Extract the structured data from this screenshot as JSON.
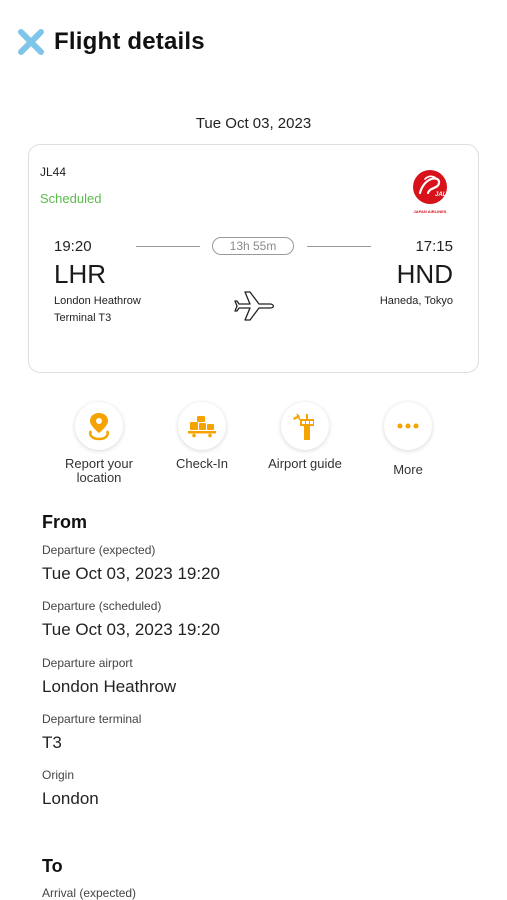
{
  "header": {
    "title": "Flight details"
  },
  "flight": {
    "date": "Tue Oct 03, 2023",
    "number": "JL44",
    "status": "Scheduled",
    "airline_logo_text": "JAPAN AIRLINES",
    "airline_logo_mark": "JAL",
    "departure": {
      "time": "19:20",
      "code": "LHR",
      "airport": "London Heathrow",
      "terminal": "Terminal T3"
    },
    "arrival": {
      "time": "17:15",
      "code": "HND",
      "airport": "Haneda, Tokyo"
    },
    "duration": "13h 55m"
  },
  "actions": [
    {
      "label": "Report your location",
      "icon": "location-pin-icon"
    },
    {
      "label": "Check-In",
      "icon": "luggage-cart-icon"
    },
    {
      "label": "Airport guide",
      "icon": "control-tower-icon"
    },
    {
      "label": "More",
      "icon": "more-dots-icon"
    }
  ],
  "from": {
    "title": "From",
    "fields": [
      {
        "label": "Departure (expected)",
        "value": "Tue Oct 03, 2023 19:20"
      },
      {
        "label": "Departure (scheduled)",
        "value": "Tue Oct 03, 2023 19:20"
      },
      {
        "label": "Departure airport",
        "value": "London Heathrow"
      },
      {
        "label": "Departure terminal",
        "value": "T3"
      },
      {
        "label": "Origin",
        "value": "London"
      }
    ]
  },
  "to": {
    "title": "To",
    "fields": [
      {
        "label": "Arrival (expected)"
      }
    ]
  },
  "colors": {
    "accent": "#f5a300",
    "close_icon": "#7fc4e9",
    "status_green": "#5dbb4d",
    "airline_red": "#d7121b"
  }
}
